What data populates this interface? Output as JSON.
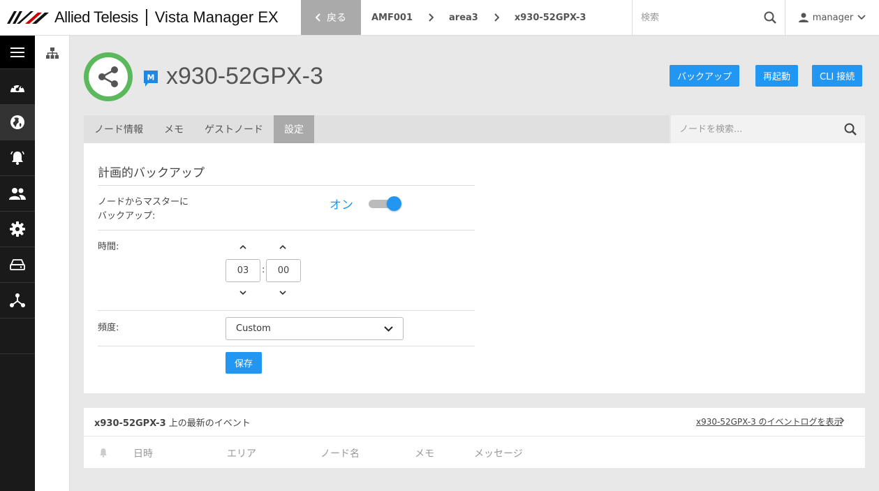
{
  "header": {
    "company": "Allied Telesis",
    "product": "Vista Manager EX",
    "back_label": "戻る",
    "breadcrumbs": [
      "AMF001",
      "area3",
      "x930-52GPX-3"
    ],
    "search_placeholder": "検索",
    "user": "manager"
  },
  "nav": {
    "items": [
      "menu-icon",
      "dashboard-icon",
      "globe-icon",
      "bell-icon",
      "users-icon",
      "gear-icon",
      "storage-icon",
      "topology-icon"
    ],
    "active": "globe-icon"
  },
  "node": {
    "title": "x930-52GPX-3",
    "badge": "M",
    "status_color": "#5cb85c",
    "actions": {
      "backup": "バックアップ",
      "reboot": "再起動",
      "cli": "CLI 接続"
    }
  },
  "tabs": {
    "items": [
      "ノード情報",
      "メモ",
      "ゲストノード",
      "設定"
    ],
    "active": "設定"
  },
  "node_search": {
    "placeholder": "ノードを検索..."
  },
  "settings": {
    "title": "計画的バックアップ",
    "backup_label_line1": "ノードからマスターに",
    "backup_label_line2": "バックアップ:",
    "backup_state": "オン",
    "backup_enabled": true,
    "time_label": "時間:",
    "hour": "03",
    "minute": "00",
    "time_separator": ":",
    "frequency_label": "頻度:",
    "frequency_value": "Custom",
    "save_label": "保存"
  },
  "events": {
    "title_node": "x930-52GPX-3",
    "title_suffix": " 上の最新のイベント",
    "link": "x930-52GPX-3 のイベントログを表示",
    "columns": [
      "日時",
      "エリア",
      "ノード名",
      "メモ",
      "メッセージ"
    ]
  },
  "colors": {
    "accent": "#2196f3",
    "nav_bg": "#1a1a1a"
  }
}
